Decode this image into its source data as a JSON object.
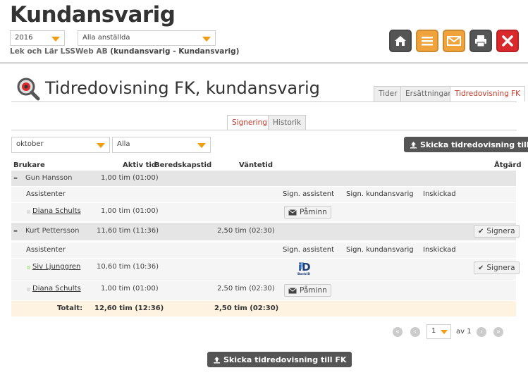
{
  "header": {
    "title": "Kundansvarig",
    "year_select": "2016",
    "employee_select": "Alla anställda",
    "org_name": "Lek och Lär LSSWeb AB",
    "org_role": "(kundansvarig - Kundansvarig)"
  },
  "toolbar": {
    "home": "home-icon",
    "menu": "menu-icon",
    "mail": "mail-icon",
    "print": "print-icon",
    "close": "close-icon"
  },
  "page": {
    "title": "Tidredovisning FK, kundansvarig",
    "tabs": [
      "Tider",
      "Ersättningar",
      "Tidredovisning FK"
    ],
    "subtabs": [
      "Signering",
      "Historik"
    ]
  },
  "filters": {
    "month": "oktober",
    "scope": "Alla"
  },
  "actions": {
    "send_fk": "Skicka tidredovisning till FK",
    "remind": "Påminn",
    "sign": "Signera"
  },
  "table": {
    "headers": [
      "Brukare",
      "Aktiv tid",
      "Beredskapstid",
      "Väntetid",
      "Åtgärd"
    ],
    "sub_headers": [
      "Assistenter",
      "Sign. assistent",
      "Sign. kundansvarig",
      "Inskickad"
    ],
    "groups": [
      {
        "name": "Gun Hansson",
        "active": "1,00 tim (01:00)",
        "waiting": "",
        "assistants": [
          {
            "name": "Diana Schults",
            "active": "1,00 tim (01:00)",
            "waiting": ""
          }
        ]
      },
      {
        "name": "Kurt Pettersson",
        "active": "11,60 tim (11:36)",
        "waiting": "2,50 tim (02:30)",
        "assistants": [
          {
            "name": "Siv Ljunggren",
            "active": "10,60 tim (10:36)",
            "waiting": "",
            "bankid": "BankID"
          },
          {
            "name": "Diana Schults",
            "active": "1,00 tim (01:00)",
            "waiting": "2,50 tim (02:30)"
          }
        ]
      }
    ],
    "total_label": "Totalt:",
    "total_active": "12,60 tim (12:36)",
    "total_waiting": "2,50 tim (02:30)"
  },
  "pager": {
    "page": "1",
    "of_label": "av 1"
  }
}
